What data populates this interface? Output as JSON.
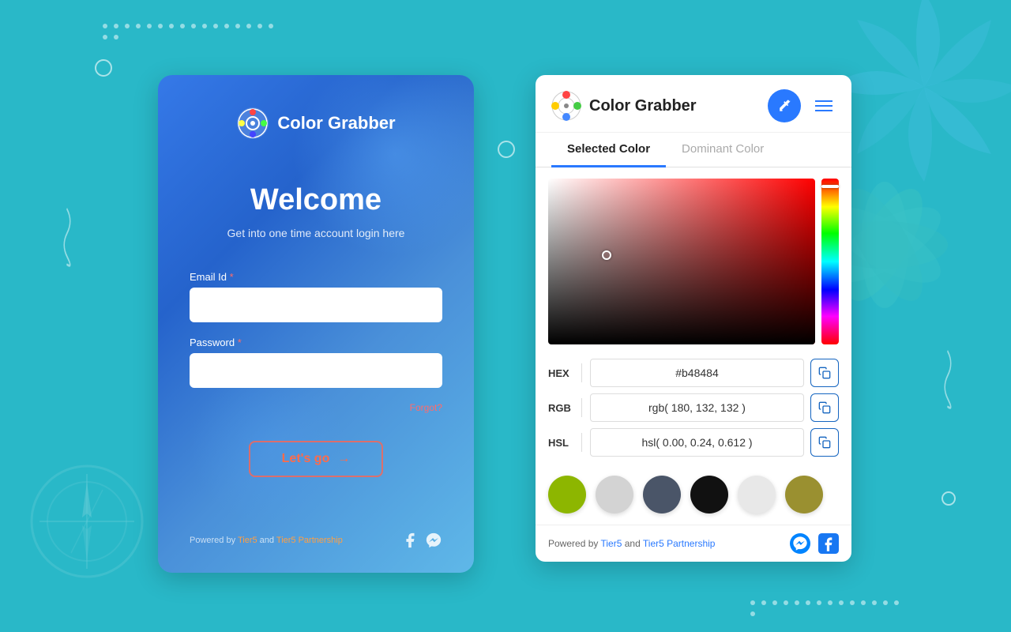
{
  "background": {
    "color": "#29b8c8"
  },
  "login": {
    "app_title": "Color Grabber",
    "welcome_title": "Welcome",
    "subtitle": "Get into one time account login here",
    "email_label": "Email Id",
    "password_label": "Password",
    "email_placeholder": "",
    "password_placeholder": "",
    "forgot_label": "Forgot?",
    "submit_label": "Let's go",
    "powered_by_prefix": "Powered by ",
    "powered_by_link1": "Tier5",
    "powered_by_and": " and ",
    "powered_by_link2": "Tier5 Partnership"
  },
  "color_grabber": {
    "app_title": "Color Grabber",
    "tabs": [
      {
        "id": "selected",
        "label": "Selected Color",
        "active": true
      },
      {
        "id": "dominant",
        "label": "Dominant Color",
        "active": false
      }
    ],
    "hex_label": "HEX",
    "hex_value": "#b48484",
    "rgb_label": "RGB",
    "rgb_value": "rgb( 180, 132, 132 )",
    "hsl_label": "HSL",
    "hsl_value": "hsl( 0.00, 0.24, 0.612 )",
    "swatches": [
      {
        "color": "#8db600",
        "name": "yellow-green"
      },
      {
        "color": "#d3d3d3",
        "name": "light-gray"
      },
      {
        "color": "#4a5568",
        "name": "slate-blue"
      },
      {
        "color": "#111111",
        "name": "near-black"
      },
      {
        "color": "#e8e8e8",
        "name": "very-light-gray"
      },
      {
        "color": "#9a9030",
        "name": "olive"
      }
    ],
    "powered_by_prefix": "Powered by ",
    "powered_by_link1": "Tier5",
    "powered_by_and": " and ",
    "powered_by_link2": "Tier5 Partnership",
    "copy_icon": "⧉",
    "eyedropper_icon": "✏",
    "menu_icon": "≡"
  }
}
